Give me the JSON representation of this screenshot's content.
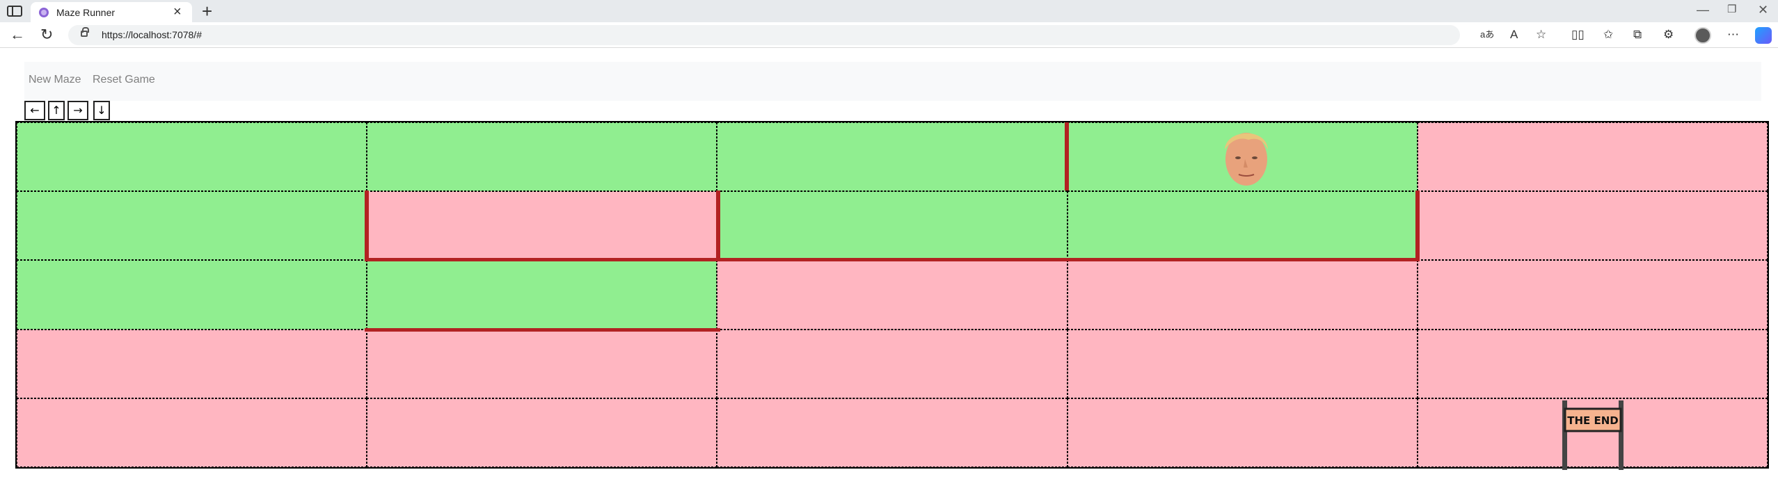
{
  "browser": {
    "tab_title": "Maze Runner",
    "url": "https://localhost:7078/#",
    "icons": [
      "tab-strip-icon",
      "close-icon",
      "plus-icon",
      "back-icon",
      "refresh-icon",
      "lock-icon",
      "read-aloud-icon",
      "text-size-icon",
      "star-icon",
      "split-screen-icon",
      "favorites-icon",
      "collections-icon",
      "extensions-icon",
      "profile-icon",
      "more-icon",
      "copilot-icon"
    ]
  },
  "navbar": {
    "new_maze": "New Maze",
    "reset_game": "Reset Game"
  },
  "controls": {
    "left": "←",
    "up": "↑",
    "right": "→",
    "down": "↓"
  },
  "maze": {
    "rows": 5,
    "cols": 5,
    "cells": [
      [
        "green",
        "green",
        "green",
        "green",
        "pink"
      ],
      [
        "green",
        "pink",
        "green",
        "green",
        "pink"
      ],
      [
        "green",
        "green",
        "pink",
        "pink",
        "pink"
      ],
      [
        "pink",
        "pink",
        "pink",
        "pink",
        "pink"
      ],
      [
        "pink",
        "pink",
        "pink",
        "pink",
        "pink"
      ]
    ],
    "colors": {
      "green": "#90ee90",
      "pink": "#ffb6c1",
      "wall": "#b22222"
    },
    "player": {
      "row": 0,
      "col": 3
    },
    "goal": {
      "row": 4,
      "col": 4,
      "label": "THE END"
    }
  }
}
